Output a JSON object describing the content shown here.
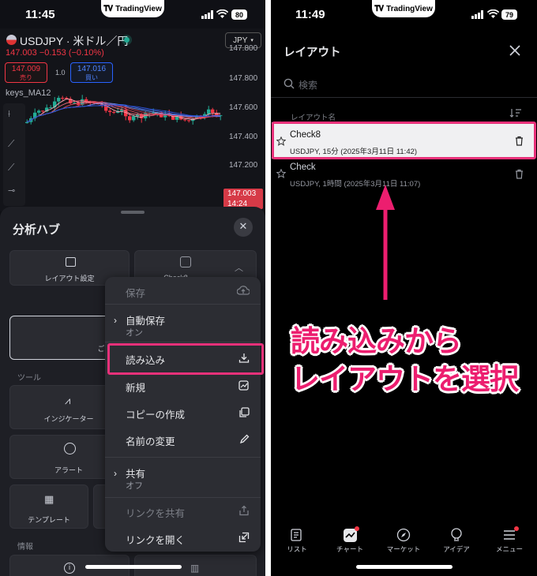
{
  "left_screen": {
    "status": {
      "time": "11:45",
      "battery": "80",
      "brand": "TradingView"
    },
    "chart": {
      "symbol": "USDJPY · 米ドル／円",
      "price_change": "147.003  −0.153 (−0.10%)",
      "sell": {
        "price": "147.009",
        "label": "売り"
      },
      "spread": "1.0",
      "buy": {
        "price": "147.016",
        "label": "買い"
      },
      "indicator": "keys_MA12",
      "currency_selector": "JPY",
      "y_axis": [
        "147.800",
        "147.600",
        "147.400",
        "147.200"
      ],
      "last_price": "147.003",
      "countdown": "14:24"
    },
    "sheet": {
      "title": "分析ハブ",
      "tile_layout_settings": "レイアウト設定",
      "tile_check8": "Check8",
      "tile_available": "ご利用",
      "section_tools": "ツール",
      "tile_indicators": "インジケーター",
      "tile_alerts": "アラート",
      "tile_templates": "テンプレート",
      "section_info": "情報"
    },
    "menu": {
      "save": "保存",
      "autosave": "自動保存",
      "autosave_state": "オン",
      "load": "読み込み",
      "new": "新規",
      "copy": "コピーの作成",
      "rename": "名前の変更",
      "share": "共有",
      "share_state": "オフ",
      "share_link": "リンクを共有",
      "open_link": "リンクを開く"
    }
  },
  "right_screen": {
    "status": {
      "time": "11:49",
      "battery": "79",
      "brand": "TradingView"
    },
    "title": "レイアウト",
    "search_placeholder": "検索",
    "column_header": "レイアウト名",
    "layouts": [
      {
        "name": "Check8",
        "desc": "USDJPY, 15分 (2025年3月11日 11:42)",
        "selected": true
      },
      {
        "name": "Check",
        "desc": "USDJPY, 1時間 (2025年3月11日 11:07)",
        "selected": false
      }
    ],
    "tabbar": {
      "list": "リスト",
      "chart": "チャート",
      "market": "マーケット",
      "ideas": "アイデア",
      "menu": "メニュー"
    },
    "caption_line1": "読み込みから",
    "caption_line2": "レイアウトを選択"
  },
  "colors": {
    "highlight": "#e8317a",
    "caption": "#ec1e6f",
    "buy": "#2962ff",
    "sell": "#f23645"
  }
}
